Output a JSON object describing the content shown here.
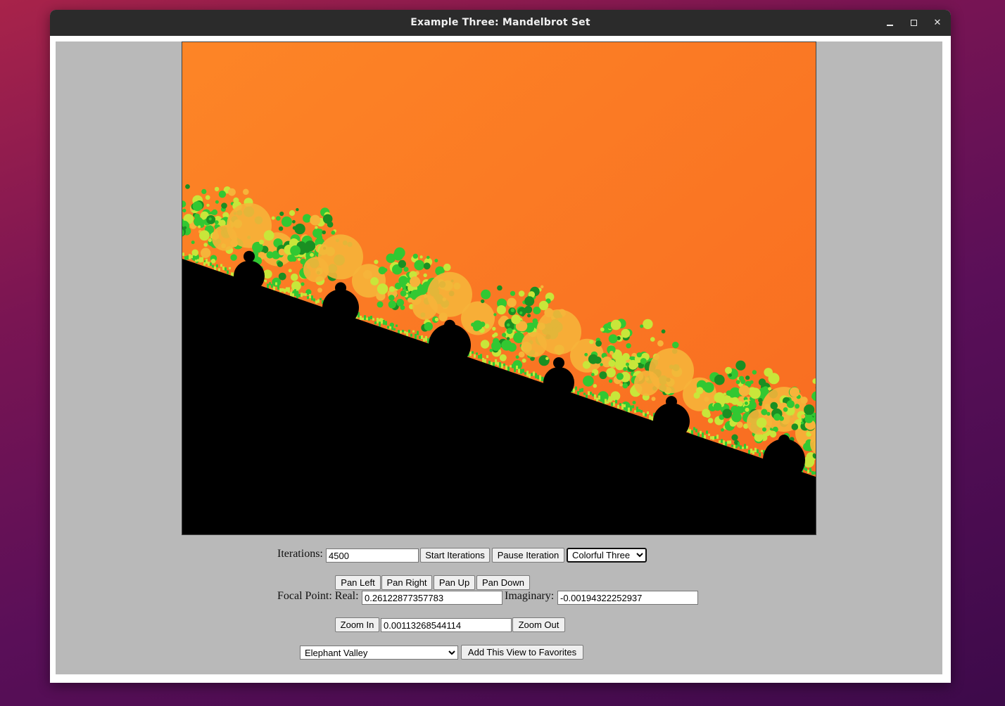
{
  "window": {
    "title": "Example Three: Mandelbrot Set",
    "controls": [
      "minimize-icon",
      "maximize-icon",
      "close-icon"
    ]
  },
  "fractal": {
    "colors": {
      "exterior_orange": "#fc7a23",
      "bulb_yellow": "#f6b43a",
      "filament_green": "#32c832",
      "set_black": "#000000"
    }
  },
  "controls": {
    "iterations_label": "Iterations:",
    "iterations_value": "4500",
    "start_button": "Start Iterations",
    "pause_button": "Pause Iteration",
    "palette_selected": "Colorful Three",
    "pan_left": "Pan Left",
    "pan_right": "Pan Right",
    "pan_up": "Pan Up",
    "pan_down": "Pan Down",
    "focal_label": "Focal Point: Real:",
    "real_value": "0.26122877357783",
    "imaginary_label": "Imaginary:",
    "imaginary_value": "-0.00194322252937",
    "zoom_in": "Zoom In",
    "zoom_value": "0.00113268544114",
    "zoom_out": "Zoom Out",
    "favorite_selected": "Elephant Valley",
    "add_favorite": "Add This View to Favorites"
  }
}
